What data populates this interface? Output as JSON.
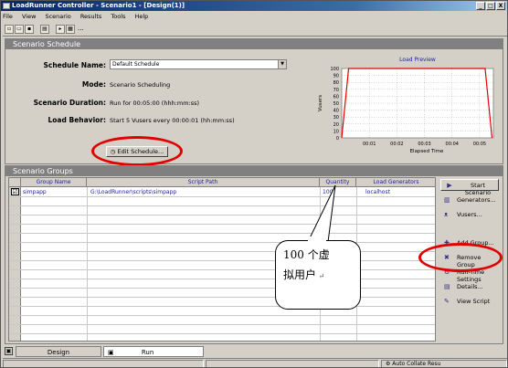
{
  "window": {
    "title": "LoadRunner Controller - Scenario1 - [Design(1)]",
    "controls": [
      "_",
      "□",
      "X"
    ]
  },
  "menu": [
    "File",
    "View",
    "Scenario",
    "Results",
    "Tools",
    "Help"
  ],
  "toolbar": {
    "icons": [
      "new-icon",
      "open-icon",
      "save-icon",
      "print-icon",
      "run-icon",
      "monitor-icon"
    ],
    "overflow": "..."
  },
  "schedule": {
    "header": "Scenario Schedule",
    "name_label": "Schedule Name:",
    "name_value": "Default Schedule",
    "mode_label": "Mode:",
    "mode_value": "Scenario Scheduling",
    "duration_label": "Scenario Duration:",
    "duration_value": "Run for 00:05:00 (hhh:mm:ss)",
    "behavior_label": "Load Behavior:",
    "behavior_value": "Start 5 Vusers every 00:00:01 (hh:mm:ss)",
    "edit_button": "Edit Schedule..."
  },
  "chart_data": {
    "type": "line",
    "title": "Load Preview",
    "xlabel": "Elapsed Time",
    "ylabel": "Vusers",
    "x_ticks": [
      "00:01",
      "00:02",
      "00:03",
      "00:04",
      "00:05"
    ],
    "y_ticks": [
      "0",
      "10",
      "20",
      "30",
      "40",
      "50",
      "60",
      "70",
      "80",
      "90",
      "100"
    ],
    "ylim": [
      0,
      100
    ],
    "xlim": [
      0,
      5.5
    ],
    "series": [
      {
        "x": [
          0,
          0.25,
          5.2,
          5.45
        ],
        "y": [
          0,
          100,
          100,
          0
        ],
        "color": "#e00000"
      }
    ],
    "grid": true
  },
  "groups": {
    "header": "Scenario Groups",
    "columns": [
      "Group Name",
      "Script Path",
      "Quantity",
      "Load Generators"
    ],
    "rows": [
      {
        "name": "simpapp",
        "path": "G:\\LoadRunner\\scripts\\simpapp",
        "quantity": "100",
        "generator": "localhost"
      }
    ]
  },
  "side_buttons": [
    {
      "label": "Start Scenario",
      "icon": "play-icon"
    },
    {
      "label": "Generators...",
      "icon": "generator-icon"
    },
    {
      "label": "Vusers...",
      "icon": "vusers-icon"
    },
    {
      "label": "Add Group...",
      "icon": "add-group-icon"
    },
    {
      "label": "Remove Group",
      "icon": "remove-group-icon"
    },
    {
      "label": "Run-Time Settings",
      "icon": "runtime-settings-icon"
    },
    {
      "label": "Details...",
      "icon": "details-icon"
    },
    {
      "label": "View Script",
      "icon": "view-script-icon"
    }
  ],
  "annotation": {
    "line1": "100 个虚",
    "line2": "拟用户"
  },
  "tabs": [
    "Design",
    "Run"
  ],
  "status": {
    "text": "Auto Collate Resu"
  },
  "colors": {
    "title_bar": "#0a246a",
    "panel_header": "#808080",
    "highlight": "#e00000"
  }
}
